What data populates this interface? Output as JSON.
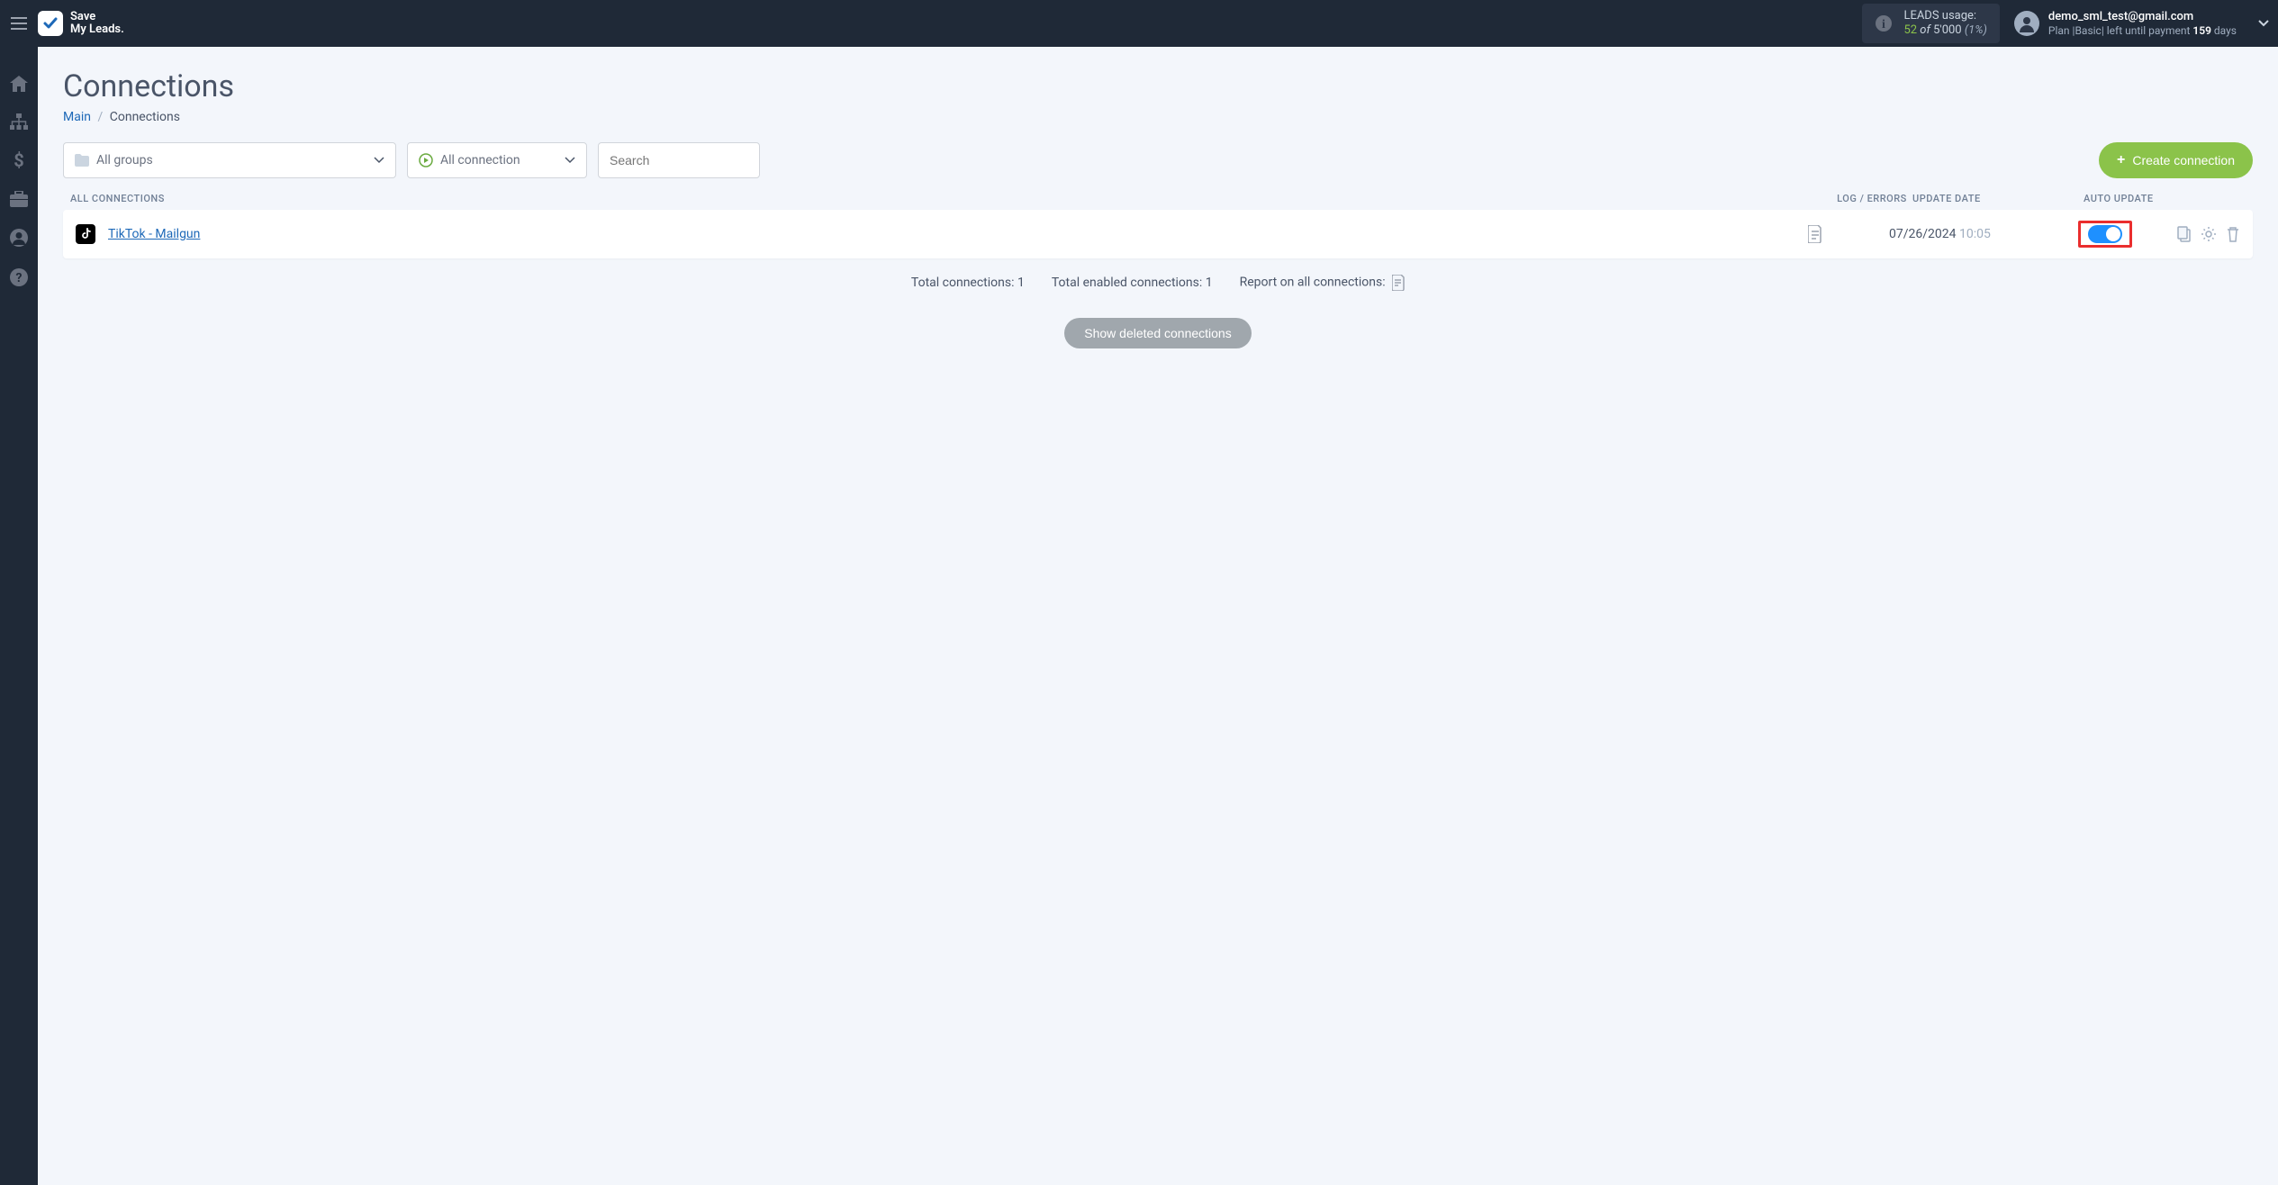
{
  "brand": {
    "line1": "Save",
    "line2": "My Leads."
  },
  "usage": {
    "label": "LEADS usage:",
    "used": "52",
    "of": "of",
    "limit": "5'000",
    "percent": "(1%)"
  },
  "account": {
    "email": "demo_sml_test@gmail.com",
    "plan_prefix": "Plan |",
    "plan_name": "Basic",
    "plan_mid": "| left until payment ",
    "days": "159",
    "days_suffix": " days"
  },
  "page": {
    "title": "Connections",
    "breadcrumb_main": "Main",
    "breadcrumb_current": "Connections"
  },
  "filters": {
    "groups_label": "All groups",
    "status_label": "All connection",
    "search_placeholder": "Search"
  },
  "create_button": "Create connection",
  "columns": {
    "name": "ALL CONNECTIONS",
    "log": "LOG / ERRORS",
    "date": "UPDATE DATE",
    "auto": "AUTO UPDATE"
  },
  "rows": [
    {
      "name": "TikTok - Mailgun",
      "date": "07/26/2024",
      "time": "10:05",
      "auto_update": true
    }
  ],
  "summary": {
    "total_label": "Total connections: ",
    "total_value": "1",
    "enabled_label": "Total enabled connections: ",
    "enabled_value": "1",
    "report_label": "Report on all connections:"
  },
  "show_deleted": "Show deleted connections"
}
